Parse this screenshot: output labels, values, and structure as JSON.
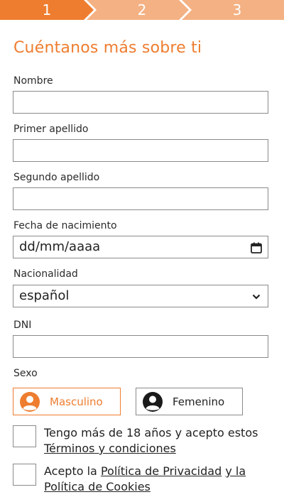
{
  "stepper": {
    "steps": [
      "1",
      "2",
      "3"
    ],
    "active_color": "#ee7d2f",
    "inactive_color": "#f4b183"
  },
  "form": {
    "title": "Cuéntanos más sobre ti",
    "nombre_label": "Nombre",
    "nombre_value": "",
    "primer_apellido_label": "Primer apellido",
    "primer_apellido_value": "",
    "segundo_apellido_label": "Segundo apellido",
    "segundo_apellido_value": "",
    "fecha_label": "Fecha de nacimiento",
    "fecha_placeholder": "dd/mm/aaaa",
    "nacionalidad_label": "Nacionalidad",
    "nacionalidad_value": "español",
    "dni_label": "DNI",
    "dni_value": "",
    "sexo_label": "Sexo",
    "sexo_options": [
      "Masculino",
      "Femenino"
    ],
    "sexo_selected": "Masculino"
  },
  "consents": {
    "age_text": "Tengo más de 18 años y acepto estos ",
    "age_link": "Términos y condiciones",
    "privacy_text": "Acepto la ",
    "privacy_link1": "Política de Privacidad",
    "privacy_mid": " ",
    "privacy_link2": "y la Política de Cookies"
  },
  "colors": {
    "accent": "#ee7d2f",
    "border": "#8a8a8a"
  }
}
